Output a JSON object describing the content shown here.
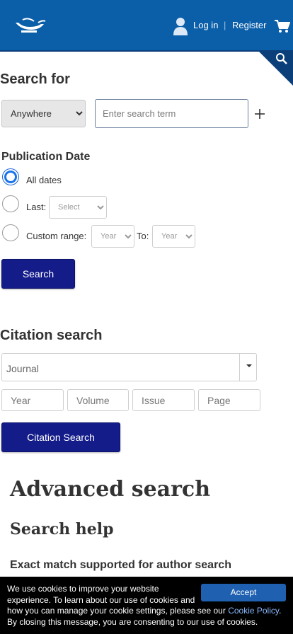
{
  "header": {
    "logo_icon": "lamp-logo-icon",
    "user_icon": "user-icon",
    "login_label": "Log in",
    "separator": "|",
    "register_label": "Register",
    "cart_icon": "cart-icon",
    "search_icon": "search-icon",
    "brand_color": "#0b5ea8"
  },
  "search": {
    "title": "Search for",
    "scope_selected": "Anywhere",
    "term_placeholder": "Enter search term",
    "add_icon": "plus-icon"
  },
  "publication_date": {
    "title": "Publication Date",
    "options": {
      "all": "All dates",
      "last": "Last:",
      "custom": "Custom range:"
    },
    "selected": "all",
    "last_select": "Select",
    "year_from": "Year",
    "to_label": "To:",
    "year_to": "Year"
  },
  "search_button": "Search",
  "citation": {
    "title": "Citation search",
    "journal_placeholder": "Journal",
    "year_placeholder": "Year",
    "volume_placeholder": "Volume",
    "issue_placeholder": "Issue",
    "page_placeholder": "Page",
    "button": "Citation Search"
  },
  "advanced": {
    "heading": "Advanced search",
    "help_heading": "Search help",
    "exact_match": "Exact match supported for author search"
  },
  "cookie": {
    "text_before": "We use cookies to improve your website experience. To learn about our use of cookies and how you can manage your cookie settings, please see our ",
    "link": "Cookie Policy",
    "text_after": ". By closing this message, you are consenting to our use of cookies.",
    "accept": "Accept"
  },
  "colors": {
    "button": "#141c8a",
    "radio_checked": "#1a73e8",
    "cookie_bg": "#000000"
  }
}
